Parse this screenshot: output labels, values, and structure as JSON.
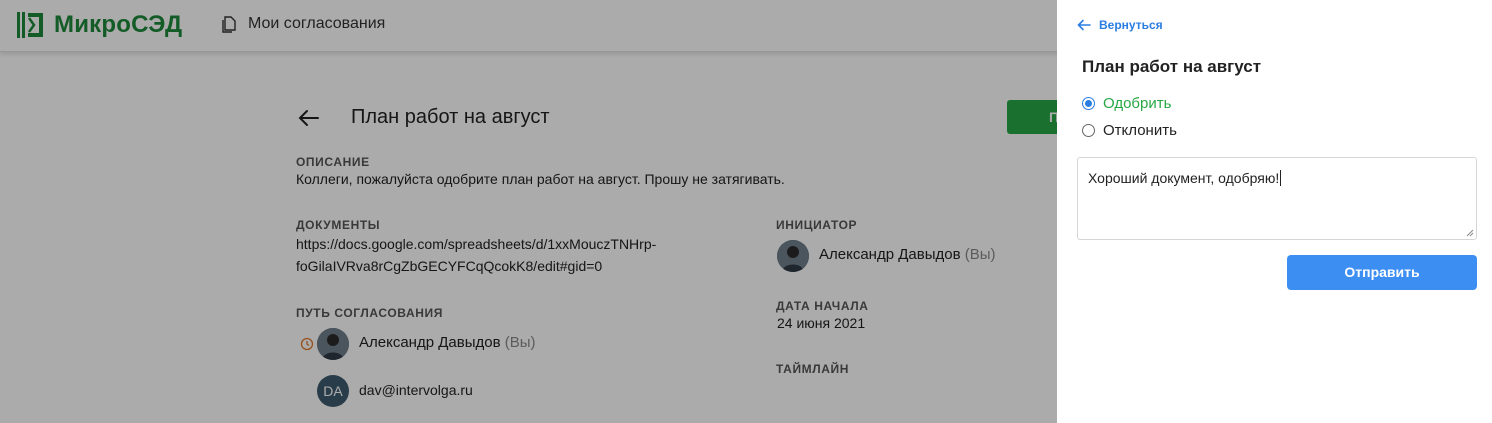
{
  "app": {
    "logo_text": "МикроСЭД",
    "brand_color": "#1f8a3b"
  },
  "header": {
    "nav_link": "Мои согласования"
  },
  "document": {
    "title": "План работ на август",
    "action_button_label": "П",
    "description_label": "ОПИСАНИЕ",
    "description": "Коллеги, пожалуйста одобрите план работ на август. Прошу не затягивать.",
    "documents_label": "ДОКУМЕНТЫ",
    "documents_line1": "https://docs.google.com/spreadsheets/d/1xxMouczTNHrp-",
    "documents_line2": "foGilaIVRva8rCgZbGECYFCqQcokK8/edit#gid=0",
    "initiator_label": "ИНИЦИАТОР",
    "initiator_name": "Александр Давыдов",
    "initiator_you": "(Вы)",
    "start_date_label": "ДАТА НАЧАЛА",
    "start_date": "24 июня 2021",
    "timeline_label": "ТАЙМЛАЙН",
    "approval_path_label": "ПУТЬ СОГЛАСОВАНИЯ",
    "approvers": [
      {
        "name": "Александр Давыдов",
        "you": "(Вы)",
        "status_icon": "clock-icon"
      },
      {
        "initials": "DA",
        "email": "dav@intervolga.ru"
      }
    ]
  },
  "panel": {
    "back_label": "Вернуться",
    "title": "План работ на август",
    "options": [
      {
        "label": "Одобрить",
        "checked": true,
        "color": "#28a745"
      },
      {
        "label": "Отклонить",
        "checked": false,
        "color": "#222222"
      }
    ],
    "comment_value": "Хороший документ, одобряю!",
    "submit_label": "Отправить",
    "accent_color": "#3d8ef2"
  }
}
